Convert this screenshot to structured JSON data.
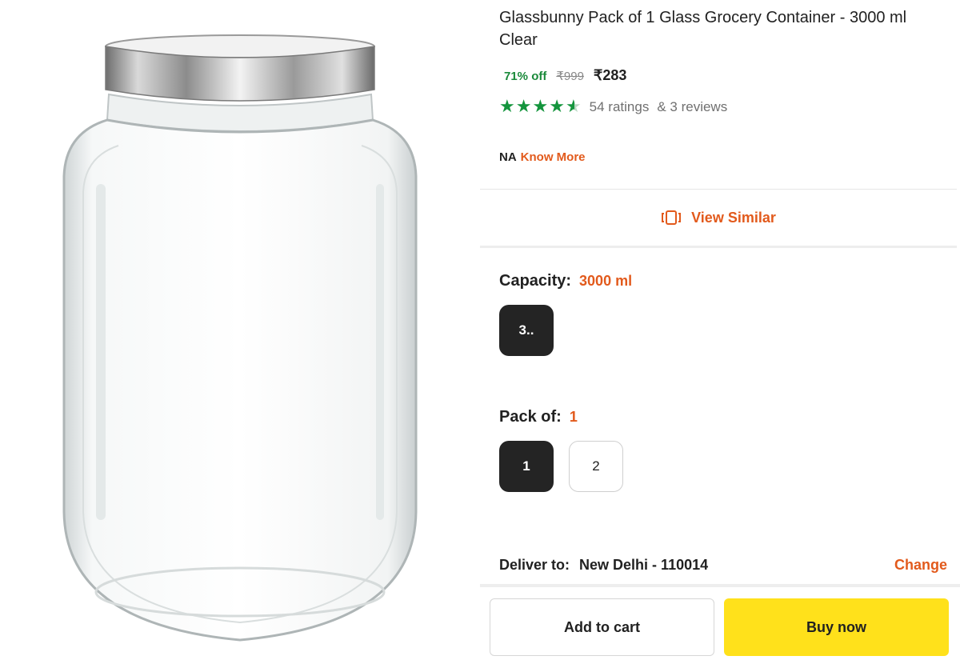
{
  "product": {
    "title": "Glassbunny Pack of 1 Glass Grocery Container  - 3000 ml Clear",
    "discount": "71% off",
    "mrp": "₹999",
    "price": "₹283",
    "rating_value": 4.5,
    "ratings_text": "54 ratings",
    "reviews_text": "& 3 reviews",
    "na_text": "NA",
    "know_more": "Know More"
  },
  "view_similar": {
    "label": "View Similar",
    "icon": "view-similar-icon"
  },
  "capacity": {
    "label": "Capacity:",
    "selected": "3000 ml",
    "options": [
      "3.."
    ]
  },
  "pack_of": {
    "label": "Pack of:",
    "selected": "1",
    "options": [
      "1",
      "2"
    ]
  },
  "delivery": {
    "label": "Deliver to:",
    "location": "New Delhi - 110014",
    "change": "Change"
  },
  "actions": {
    "add_to_cart": "Add to cart",
    "buy_now": "Buy now"
  },
  "colors": {
    "accent": "#e25a1c",
    "rating_green": "#14953d",
    "buy_yellow": "#ffe11b",
    "chip_selected": "#242424"
  }
}
